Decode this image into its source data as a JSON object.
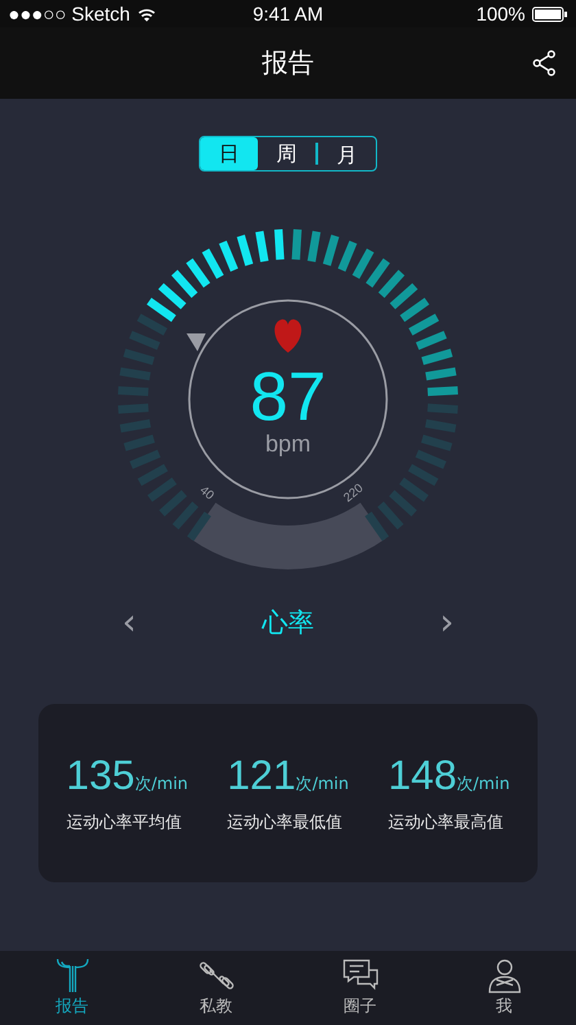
{
  "status_bar": {
    "carrier": "●●●○○ Sketch",
    "time": "9:41 AM",
    "battery": "100%"
  },
  "nav": {
    "title": "报告"
  },
  "period_tabs": [
    {
      "label": "日",
      "selected": true
    },
    {
      "label": "周",
      "selected": false
    },
    {
      "label": "月",
      "selected": false
    }
  ],
  "gauge": {
    "value": "87",
    "unit": "bpm",
    "min_label": "40",
    "max_label": "220"
  },
  "metric": {
    "prev": "‹",
    "title": "心率",
    "next": "›"
  },
  "stats": [
    {
      "value": "135",
      "unit": "次/min",
      "label": "运动心率平均值"
    },
    {
      "value": "121",
      "unit": "次/min",
      "label": "运动心率最低值"
    },
    {
      "value": "148",
      "unit": "次/min",
      "label": "运动心率最高值"
    }
  ],
  "tab_bar": [
    {
      "label": "报告",
      "kind": "report",
      "selected": true
    },
    {
      "label": "私教",
      "kind": "coach",
      "selected": false
    },
    {
      "label": "圈子",
      "kind": "chat",
      "selected": false
    },
    {
      "label": "我",
      "kind": "me",
      "selected": false
    }
  ]
}
